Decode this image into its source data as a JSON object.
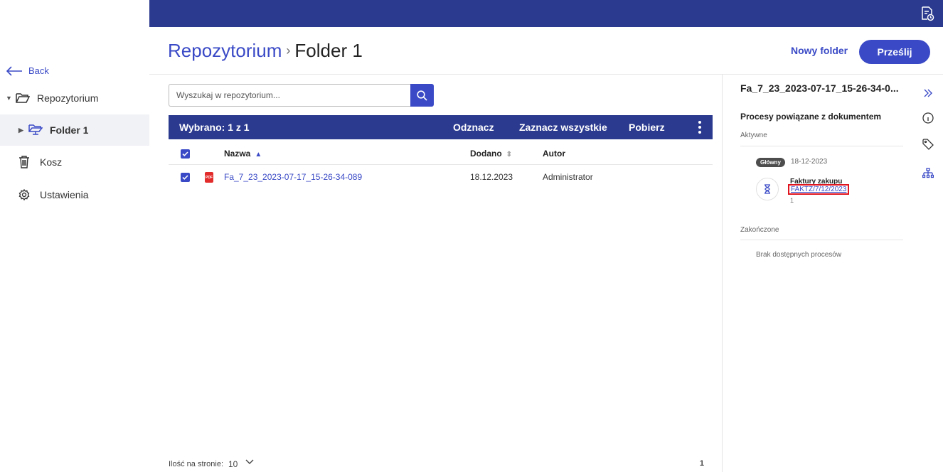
{
  "sidebar": {
    "back_label": "Back",
    "items": [
      {
        "label": "Repozytorium",
        "icon": "folder-open-icon"
      },
      {
        "label": "Folder 1",
        "icon": "folder-shared-icon",
        "active": true
      },
      {
        "label": "Kosz",
        "icon": "trash-icon"
      },
      {
        "label": "Ustawienia",
        "icon": "gear-icon"
      }
    ]
  },
  "header": {
    "breadcrumb_root": "Repozytorium",
    "breadcrumb_sep": "›",
    "breadcrumb_current": "Folder 1",
    "new_folder_label": "Nowy folder",
    "upload_label": "Prześlij"
  },
  "search": {
    "placeholder": "Wyszukaj w repozytorium..."
  },
  "selection_bar": {
    "count_text": "Wybrano: 1 z 1",
    "actions": [
      "Odznacz",
      "Zaznacz wszystkie",
      "Pobierz"
    ]
  },
  "table": {
    "columns": [
      "Nazwa",
      "Dodano",
      "Autor"
    ],
    "rows": [
      {
        "name": "Fa_7_23_2023-07-17_15-26-34-089",
        "added": "18.12.2023",
        "author": "Administrator",
        "type_badge": "PDF"
      }
    ]
  },
  "footer": {
    "per_page_label": "Ilość na stronie:",
    "per_page_value": "10",
    "page": "1"
  },
  "right_panel": {
    "file_title": "Fa_7_23_2023-07-17_15-26-34-0...",
    "section_title": "Procesy powiązane z dokumentem",
    "active_label": "Aktywne",
    "badge": "Główny",
    "badge_date": "18-12-2023",
    "process_name": "Faktury zakupu",
    "process_link": "FAKTZ/7/12/2023",
    "process_num": "1",
    "finished_label": "Zakończone",
    "no_processes": "Brak dostępnych procesów"
  },
  "colors": {
    "nav_bar": "#2b3a8f",
    "accent": "#3a4ac6",
    "highlight": "#e0141e"
  }
}
